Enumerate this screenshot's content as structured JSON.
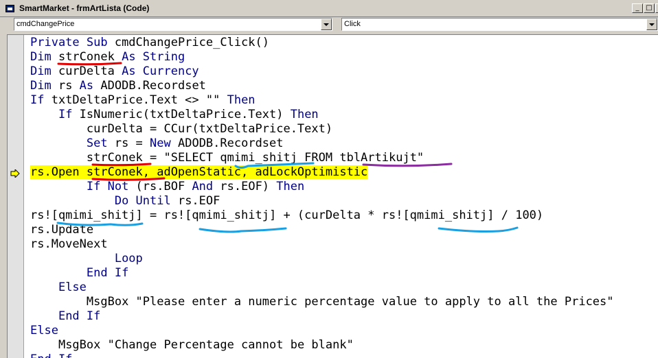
{
  "window": {
    "title": "SmartMarket - frmArtLista (Code)"
  },
  "object_combo": {
    "value": "cmdChangePrice"
  },
  "procedure_combo": {
    "value": "Click"
  },
  "code_lines": [
    {
      "indent": "",
      "tokens": [
        {
          "t": "Private Sub ",
          "kw": true
        },
        {
          "t": "cmdChangePrice_Click()"
        }
      ]
    },
    {
      "indent": "",
      "tokens": [
        {
          "t": "Dim ",
          "kw": true
        },
        {
          "t": "strConek "
        },
        {
          "t": "As String",
          "kw": true
        }
      ]
    },
    {
      "indent": "",
      "tokens": [
        {
          "t": "Dim ",
          "kw": true
        },
        {
          "t": "curDelta "
        },
        {
          "t": "As Currency",
          "kw": true
        }
      ]
    },
    {
      "indent": "",
      "tokens": [
        {
          "t": "Dim ",
          "kw": true
        },
        {
          "t": "rs "
        },
        {
          "t": "As ",
          "kw": true
        },
        {
          "t": "ADODB.Recordset"
        }
      ]
    },
    {
      "indent": "",
      "tokens": [
        {
          "t": "If ",
          "kw": true
        },
        {
          "t": "txtDeltaPrice.Text <> \"\" "
        },
        {
          "t": "Then",
          "kw": true
        }
      ]
    },
    {
      "indent": "    ",
      "tokens": [
        {
          "t": "If ",
          "kw": true
        },
        {
          "t": "IsNumeric(txtDeltaPrice.Text) "
        },
        {
          "t": "Then",
          "kw": true
        }
      ]
    },
    {
      "indent": "        ",
      "tokens": [
        {
          "t": "curDelta = CCur(txtDeltaPrice.Text)"
        }
      ]
    },
    {
      "indent": "        ",
      "tokens": [
        {
          "t": "Set ",
          "kw": true
        },
        {
          "t": "rs = "
        },
        {
          "t": "New ",
          "kw": true
        },
        {
          "t": "ADODB.Recordset"
        }
      ]
    },
    {
      "indent": "        ",
      "tokens": [
        {
          "t": "strConek = \"SELECT qmimi_shitj FROM tblArtikujt\""
        }
      ]
    },
    {
      "indent": "",
      "highlight": true,
      "tokens": [
        {
          "t": "rs.Open strConek, adOpenStatic, adLockOptimistic"
        }
      ]
    },
    {
      "indent": "        ",
      "tokens": [
        {
          "t": "If Not ",
          "kw": true
        },
        {
          "t": "(rs.BOF "
        },
        {
          "t": "And ",
          "kw": true
        },
        {
          "t": "rs.EOF) "
        },
        {
          "t": "Then",
          "kw": true
        }
      ]
    },
    {
      "indent": "            ",
      "tokens": [
        {
          "t": "Do Until ",
          "kw": true
        },
        {
          "t": "rs.EOF"
        }
      ]
    },
    {
      "indent": "",
      "tokens": [
        {
          "t": "rs![qmimi_shitj] = rs![qmimi_shitj] + (curDelta * rs![qmimi_shitj] / 100)"
        }
      ]
    },
    {
      "indent": "",
      "tokens": [
        {
          "t": "rs.Update"
        }
      ]
    },
    {
      "indent": "",
      "tokens": [
        {
          "t": "rs.MoveNext"
        }
      ]
    },
    {
      "indent": "            ",
      "tokens": [
        {
          "t": "Loop",
          "kw": true
        }
      ]
    },
    {
      "indent": "        ",
      "tokens": [
        {
          "t": "End If",
          "kw": true
        }
      ]
    },
    {
      "indent": "    ",
      "tokens": [
        {
          "t": "Else",
          "kw": true
        }
      ]
    },
    {
      "indent": "        ",
      "tokens": [
        {
          "t": "MsgBox \"Please enter a numeric percentage value to apply to all the Prices\""
        }
      ]
    },
    {
      "indent": "    ",
      "tokens": [
        {
          "t": "End If",
          "kw": true
        }
      ]
    },
    {
      "indent": "",
      "tokens": [
        {
          "t": "Else",
          "kw": true
        }
      ]
    },
    {
      "indent": "    ",
      "tokens": [
        {
          "t": "MsgBox \"Change Percentage cannot be blank\""
        }
      ]
    },
    {
      "indent": "",
      "tokens": [
        {
          "t": "End If",
          "kw": true
        }
      ]
    }
  ],
  "colors": {
    "keyword": "#00008b",
    "execution_highlight": "#ffff00",
    "markup_red": "#e00000",
    "markup_blue": "#1a9fe0",
    "markup_purple": "#8b2ca0"
  },
  "icons": [
    "app-icon",
    "minimize-icon",
    "maximize-icon",
    "close-icon",
    "dropdown-arrow-icon",
    "execution-point-arrow-icon"
  ]
}
